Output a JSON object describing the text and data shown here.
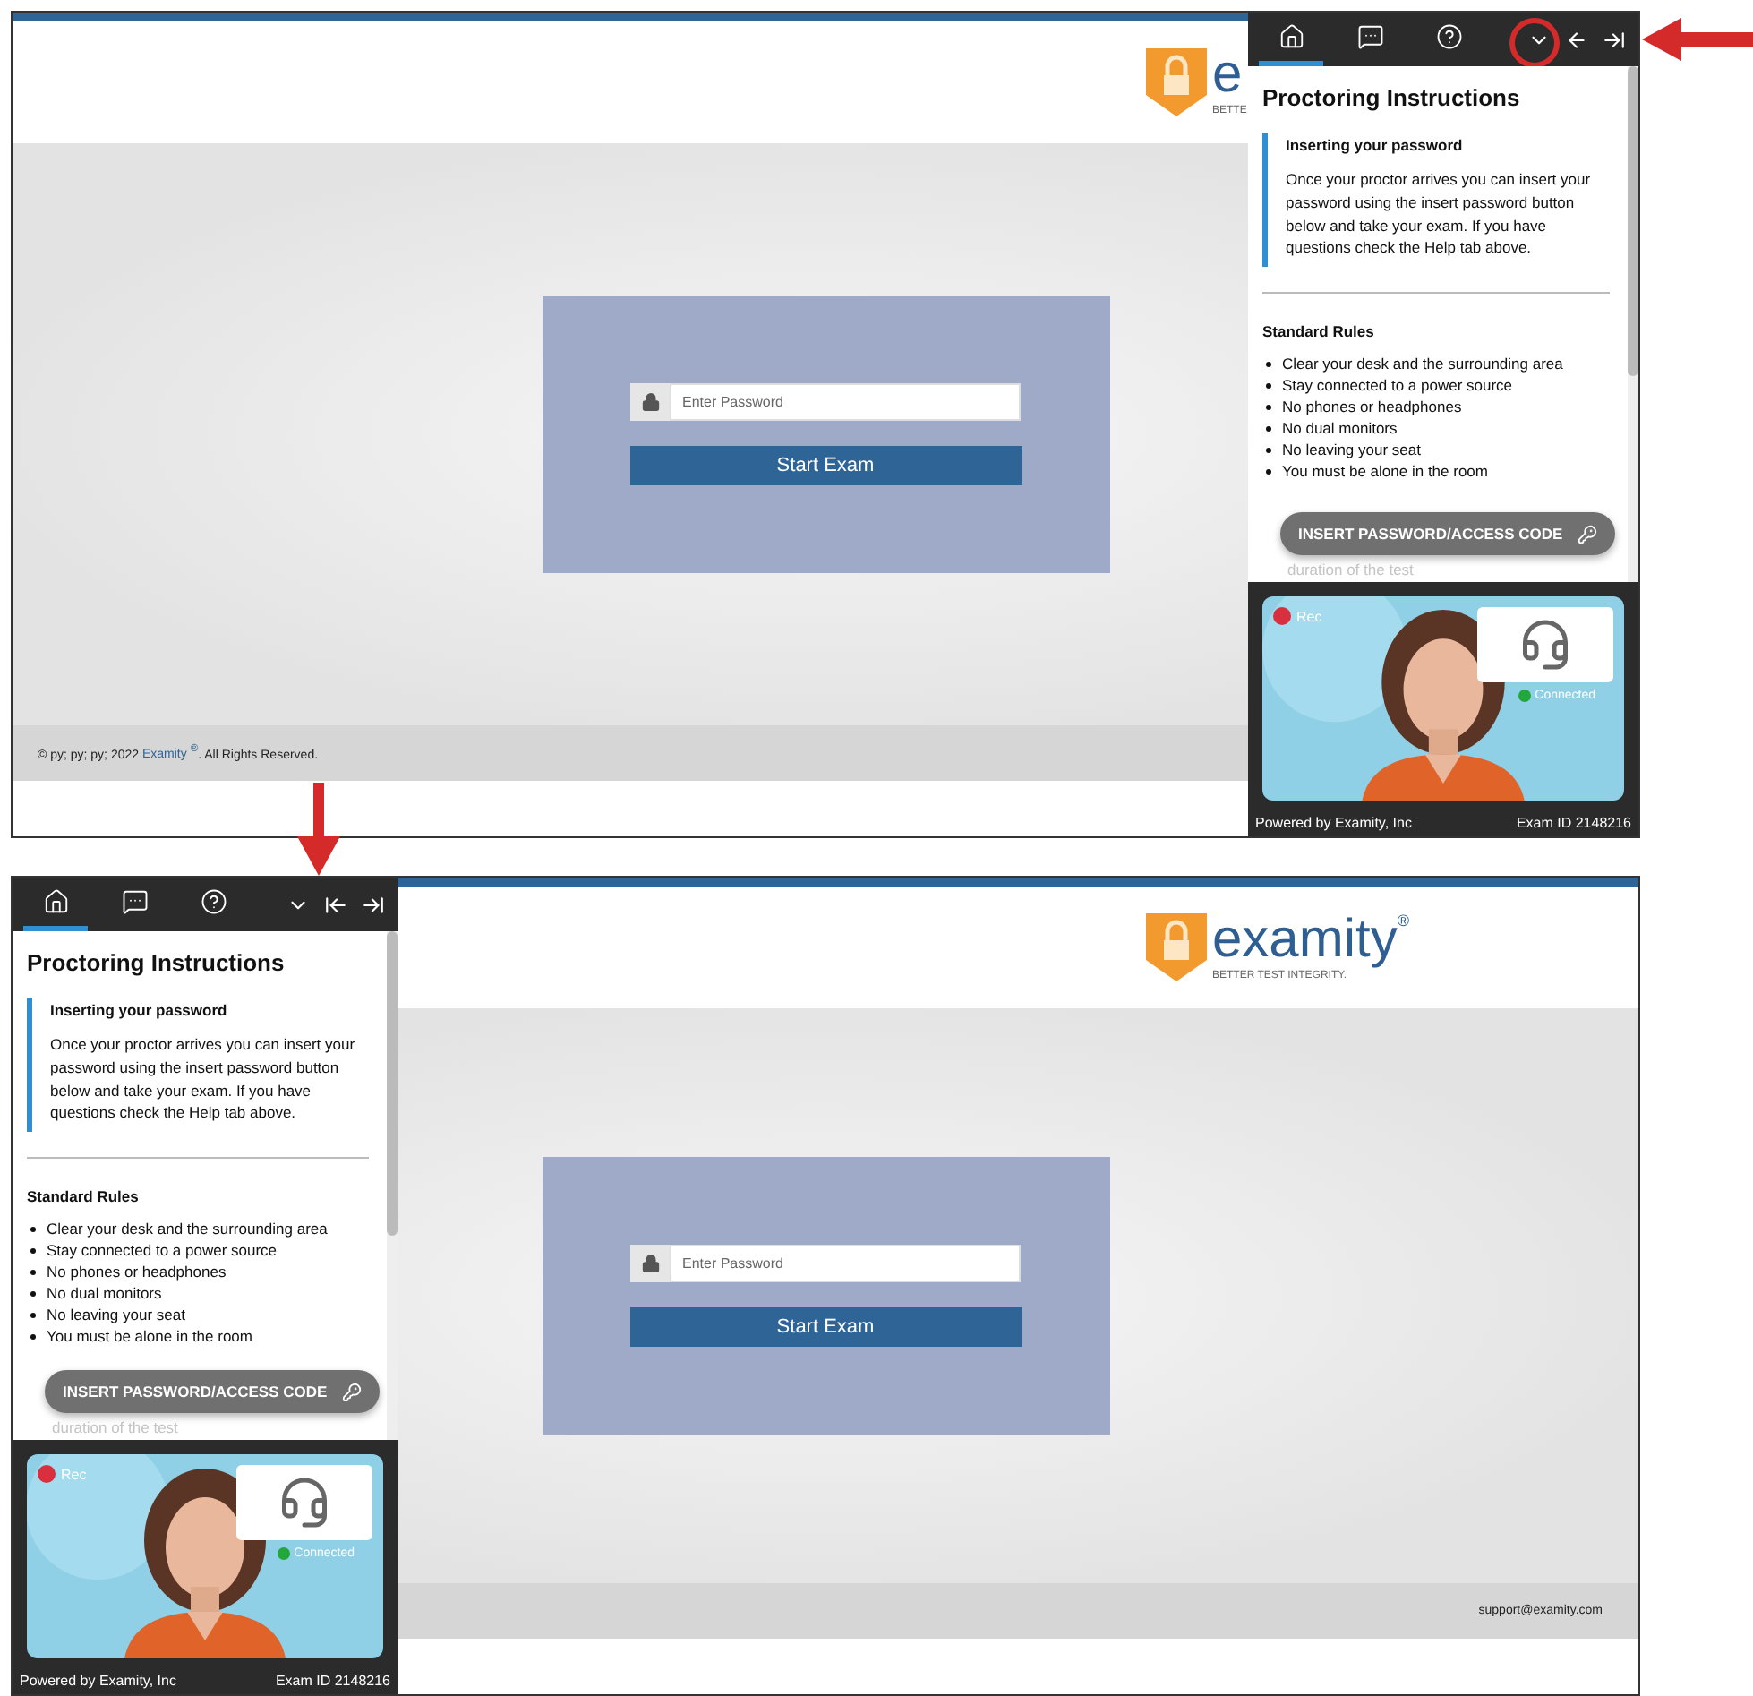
{
  "screens": [
    {
      "panel_left": false,
      "page": {
        "logo": {
          "wordmark": "e",
          "tagline": "BETTE"
        },
        "password": {
          "placeholder": "Enter Password"
        },
        "start_button": "Start Exam",
        "footer": {
          "left": "© py; py; py; 2022 ",
          "link": "Examity $^{®}$",
          "after": ". All Rights Reserved."
        }
      },
      "panel": {
        "tabs": [
          {
            "kind": "home",
            "selected": true
          },
          {
            "kind": "chat",
            "selected": false
          },
          {
            "kind": "help",
            "selected": false
          }
        ],
        "tools": [
          {
            "kind": "collapse",
            "highlighted": true
          },
          {
            "kind": "back",
            "highlighted": false
          },
          {
            "kind": "dock-right",
            "highlighted": false
          }
        ],
        "title": "Proctoring Instructions",
        "callout": {
          "heading": "Inserting your password",
          "body": "Once your proctor arrives you can insert your password using the insert password button below and take your exam. If you have questions check the Help tab above."
        },
        "rules_heading": "Standard Rules",
        "rules": [
          "Clear your desk and the surrounding area",
          "Stay connected to a power source",
          "No phones or headphones",
          "No dual monitors",
          "No leaving your seat",
          "You must be alone in the room"
        ],
        "faded_text": "duration of the test",
        "insert_button": "INSERT PASSWORD/ACCESS CODE",
        "video": {
          "rec": "Rec",
          "status": "Connected"
        },
        "footer_left": "Powered by Examity, Inc",
        "footer_right": "Exam ID 2148216"
      }
    },
    {
      "panel_left": true,
      "page": {
        "logo": {
          "wordmark": "examity",
          "mark": "®",
          "tagline": "BETTER TEST INTEGRITY."
        },
        "password": {
          "placeholder": "Enter Password"
        },
        "start_button": "Start Exam",
        "footer": {
          "right": "support@examity.com"
        }
      },
      "panel": {
        "tabs": [
          {
            "kind": "home",
            "selected": true
          },
          {
            "kind": "chat",
            "selected": false
          },
          {
            "kind": "help",
            "selected": false
          }
        ],
        "tools": [
          {
            "kind": "collapse",
            "highlighted": false
          },
          {
            "kind": "dock-left",
            "highlighted": false
          },
          {
            "kind": "dock-right",
            "highlighted": false
          }
        ],
        "title": "Proctoring Instructions",
        "callout": {
          "heading": "Inserting your password",
          "body": "Once your proctor arrives you can insert your password using the insert password button below and take your exam. If you have questions check the Help tab above."
        },
        "rules_heading": "Standard Rules",
        "rules": [
          "Clear your desk and the surrounding area",
          "Stay connected to a power source",
          "No phones or headphones",
          "No dual monitors",
          "No leaving your seat",
          "You must be alone in the room"
        ],
        "faded_text": "duration of the test",
        "insert_button": "INSERT PASSWORD/ACCESS CODE",
        "video": {
          "rec": "Rec",
          "status": "Connected"
        },
        "footer_left": "Powered by Examity, Inc",
        "footer_right": "Exam ID 2148216"
      }
    }
  ]
}
